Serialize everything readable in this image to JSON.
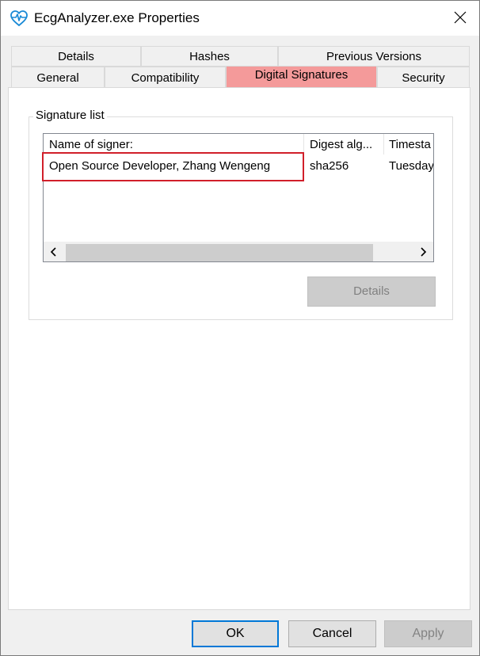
{
  "window": {
    "title": "EcgAnalyzer.exe Properties",
    "app_icon": "heart-pulse-icon",
    "close_icon": "close-icon"
  },
  "tabs": {
    "row1": [
      {
        "label": "Details"
      },
      {
        "label": "Hashes"
      },
      {
        "label": "Previous Versions"
      }
    ],
    "row2": [
      {
        "label": "General"
      },
      {
        "label": "Compatibility"
      },
      {
        "label": "Digital Signatures",
        "active": true
      },
      {
        "label": "Security"
      }
    ]
  },
  "signature_list": {
    "group_label": "Signature list",
    "columns": [
      "Name of signer:",
      "Digest alg...",
      "Timesta"
    ],
    "rows": [
      {
        "signer": "Open Source Developer, Zhang Wengeng",
        "digest": "sha256",
        "timestamp": "Tuesday"
      }
    ],
    "details_button": "Details"
  },
  "footer": {
    "ok": "OK",
    "cancel": "Cancel",
    "apply": "Apply"
  },
  "colors": {
    "active_tab": "#f49a9a",
    "highlight_border": "#d11f2a",
    "default_button_border": "#0078d7"
  }
}
